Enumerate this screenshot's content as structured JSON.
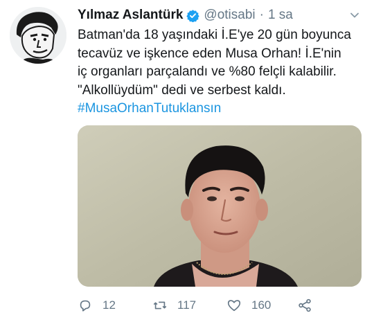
{
  "tweet": {
    "author_name": "Yılmaz Aslantürk",
    "handle": "@otisabi",
    "separator": "·",
    "time": "1 sa",
    "text_lines": [
      "Batman'da 18 yaşındaki İ.E'ye 20 gün boyunca",
      "tecavüz ve işkence eden Musa Orhan! İ.E'nin",
      "iç organları parçalandı ve %80 felçli kalabilir.",
      "\"Alkollüydüm\" dedi ve serbest kaldı."
    ],
    "hashtag": "#MusaOrhanTutuklansın"
  },
  "actions": {
    "reply_count": "12",
    "retweet_count": "117",
    "like_count": "160"
  },
  "icons": {
    "verified": "verified-badge-icon",
    "caret": "chevron-down-icon",
    "reply": "reply-icon",
    "retweet": "retweet-icon",
    "like": "heart-icon",
    "share": "share-icon"
  },
  "colors": {
    "accent": "#1b95e0",
    "muted": "#657786",
    "verified": "#1da1f2"
  }
}
